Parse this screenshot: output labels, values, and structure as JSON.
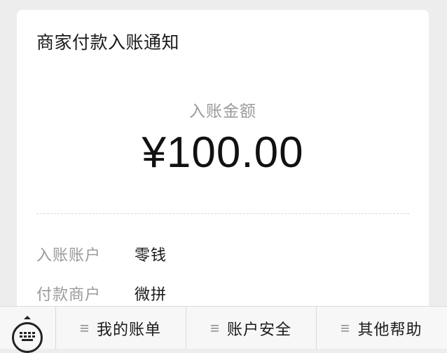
{
  "card": {
    "title": "商家付款入账通知",
    "amount_label": "入账金额",
    "amount_value": "¥100.00",
    "details": [
      {
        "label": "入账账户",
        "value": "零钱"
      },
      {
        "label": "付款商户",
        "value": "微拼"
      }
    ]
  },
  "menu": {
    "items": [
      {
        "label": "我的账单",
        "icon": "menu-list-icon"
      },
      {
        "label": "账户安全",
        "icon": "menu-list-icon"
      },
      {
        "label": "其他帮助",
        "icon": "menu-list-icon"
      }
    ],
    "keyboard_icon": "keyboard-icon"
  }
}
